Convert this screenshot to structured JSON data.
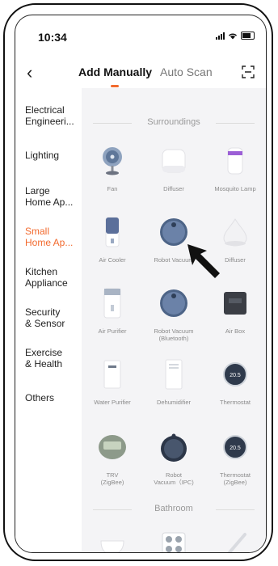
{
  "status": {
    "time": "10:34"
  },
  "nav": {
    "tab_manual": "Add Manually",
    "tab_auto": "Auto Scan",
    "accent": "#f26a2e"
  },
  "sidebar": {
    "items": [
      {
        "label": "Electrical\nEngineeri..."
      },
      {
        "label": "Lighting"
      },
      {
        "label": "Large\nHome Ap..."
      },
      {
        "label": "Small\nHome Ap..."
      },
      {
        "label": "Kitchen\nAppliance"
      },
      {
        "label": "Security\n& Sensor"
      },
      {
        "label": "Exercise\n& Health"
      },
      {
        "label": "Others"
      }
    ]
  },
  "sections": {
    "surroundings": "Surroundings",
    "bathroom": "Bathroom"
  },
  "devices": [
    {
      "label": "Fan",
      "icon": "fan-icon"
    },
    {
      "label": "Diffuser",
      "icon": "diffuser-icon"
    },
    {
      "label": "Mosquito Lamp",
      "icon": "mosquito-lamp-icon"
    },
    {
      "label": "Air Cooler",
      "icon": "air-cooler-icon"
    },
    {
      "label": "Robot Vacuum",
      "icon": "robot-vacuum-icon"
    },
    {
      "label": "Diffuser",
      "icon": "diffuser-drop-icon"
    },
    {
      "label": "Air Purifier",
      "icon": "air-purifier-icon"
    },
    {
      "label": "Robot Vacuum\n(Bluetooth)",
      "icon": "robot-vacuum-bluetooth-icon"
    },
    {
      "label": "Air Box",
      "icon": "air-box-icon"
    },
    {
      "label": "Water Purifier",
      "icon": "water-purifier-icon"
    },
    {
      "label": "Dehumidifier",
      "icon": "dehumidifier-icon"
    },
    {
      "label": "Thermostat",
      "icon": "thermostat-icon",
      "readout": "20.5"
    },
    {
      "label": "TRV\n(ZigBee)",
      "icon": "trv-icon"
    },
    {
      "label": "Robot\nVacuum（IPC)",
      "icon": "robot-vacuum-ipc-icon"
    },
    {
      "label": "Thermostat\n(ZigBee)",
      "icon": "thermostat-zigbee-icon",
      "readout": "20.5"
    }
  ]
}
